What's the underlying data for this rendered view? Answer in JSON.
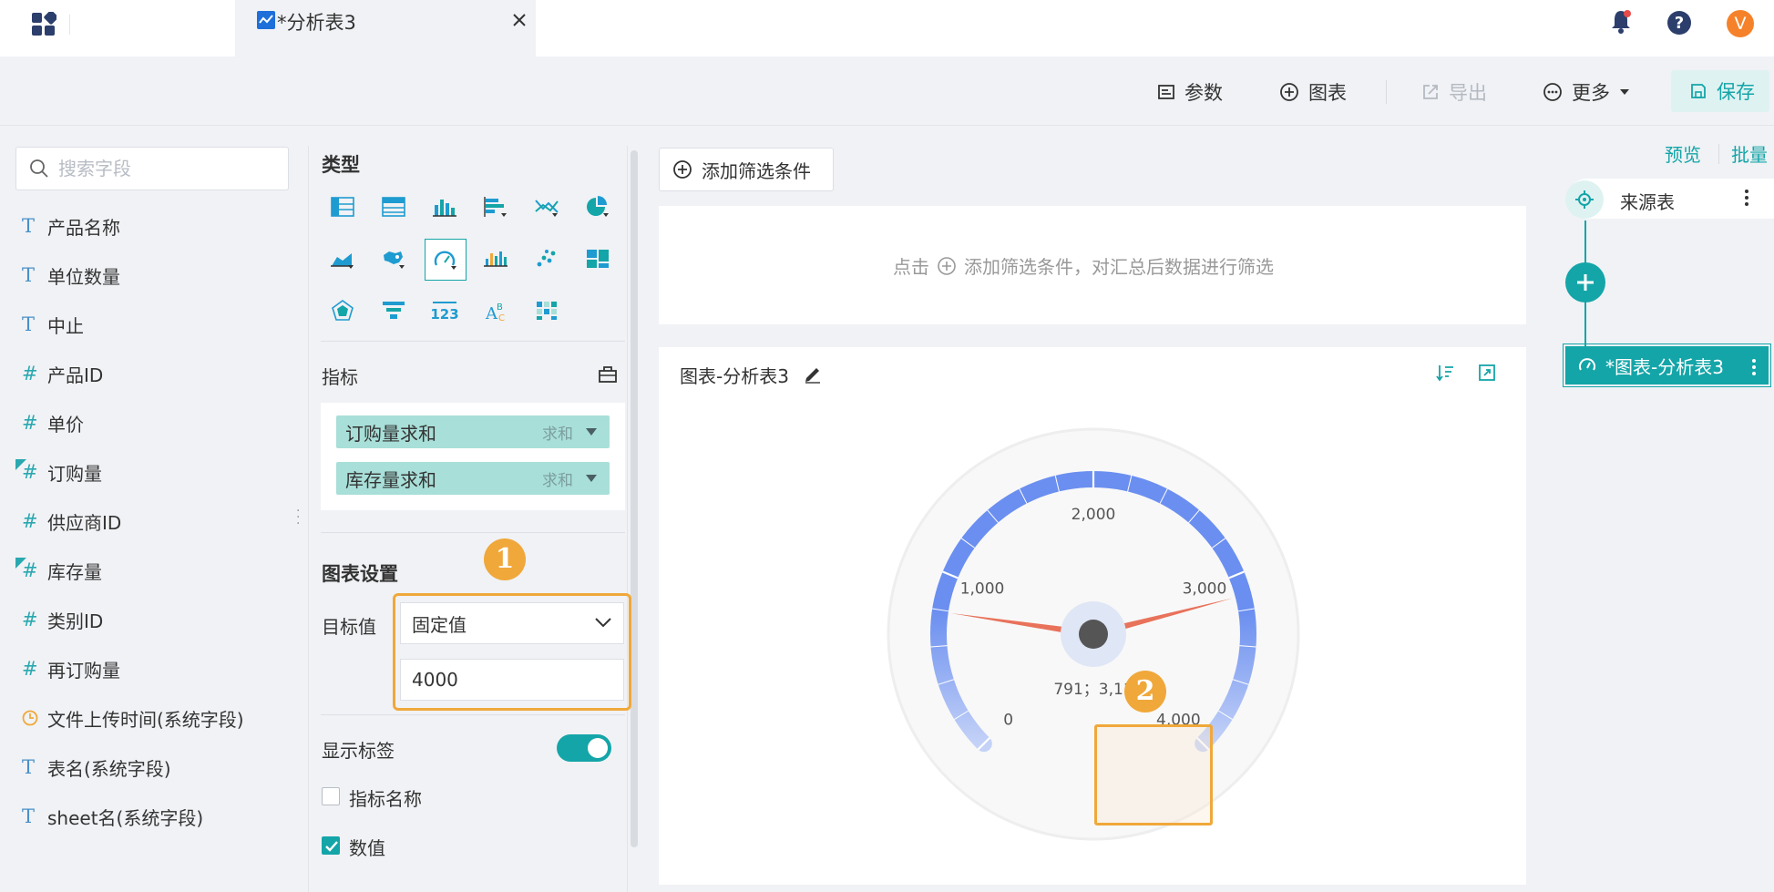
{
  "header": {
    "tab_title": "*分析表3",
    "avatar_letter": "V"
  },
  "toolbar": {
    "params": "参数",
    "chart": "图表",
    "export": "导出",
    "more": "更多",
    "save": "保存"
  },
  "fields_panel": {
    "search_placeholder": "搜索字段",
    "fields": [
      {
        "type": "T",
        "label": "产品名称"
      },
      {
        "type": "T",
        "label": "单位数量"
      },
      {
        "type": "T",
        "label": "中止"
      },
      {
        "type": "#",
        "label": "产品ID"
      },
      {
        "type": "#",
        "label": "单价"
      },
      {
        "type": "#",
        "label": "订购量"
      },
      {
        "type": "#",
        "label": "供应商ID"
      },
      {
        "type": "#",
        "label": "库存量"
      },
      {
        "type": "#",
        "label": "类别ID"
      },
      {
        "type": "#",
        "label": "再订购量"
      },
      {
        "type": "time",
        "label": "文件上传时间(系统字段)"
      },
      {
        "type": "T",
        "label": "表名(系统字段)"
      },
      {
        "type": "T",
        "label": "sheet名(系统字段)"
      }
    ]
  },
  "config": {
    "type_title": "类型",
    "metrics_title": "指标",
    "metrics": [
      {
        "label": "订购量求和",
        "agg": "求和"
      },
      {
        "label": "库存量求和",
        "agg": "求和"
      }
    ],
    "settings_title": "图表设置",
    "target_label": "目标值",
    "target_mode": "固定值",
    "target_value": "4000",
    "show_labels": "显示标签",
    "show_labels_on": true,
    "metric_name": "指标名称",
    "metric_name_checked": false,
    "value_label": "数值",
    "value_checked": true,
    "badge1": "1",
    "badge2": "2"
  },
  "center": {
    "add_filter": "添加筛选条件",
    "filter_hint_click": "点击",
    "filter_hint_rest": "添加筛选条件，对汇总后数据进行筛选",
    "chart_title": "图表-分析表3"
  },
  "chart_data": {
    "type": "gauge",
    "min": 0,
    "max": 4000,
    "ticks": [
      "0",
      "1,000",
      "2,000",
      "3,000",
      "4,000"
    ],
    "values": [
      791,
      3119
    ],
    "value_label": "791；3,11",
    "colors": {
      "arc": "#6b8ff0",
      "needle": "#e8725a",
      "hub": "#555555"
    }
  },
  "right_panel": {
    "preview": "预览",
    "batch": "批量",
    "source_node": "来源表",
    "chart_node": "*图表-分析表3"
  }
}
